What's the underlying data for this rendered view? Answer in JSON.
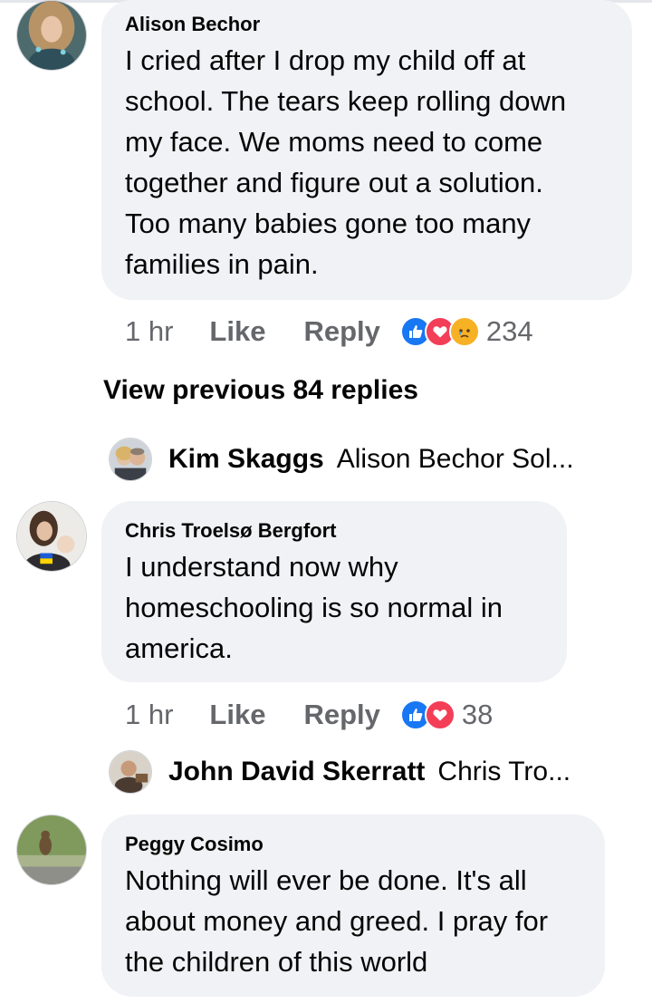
{
  "comments": [
    {
      "author": "Alison Bechor",
      "lines": [
        "I cried after I drop my child off at",
        "school. The tears keep rolling down",
        "my face. We moms need to come",
        "together and figure out a solution.",
        "Too many babies gone too many",
        "families in pain."
      ],
      "time": "1 hr",
      "like": "Like",
      "reply": "Reply",
      "reaction_count": "234",
      "reactions": [
        "like-icon",
        "love-icon",
        "sad-icon"
      ]
    },
    {
      "author": "Chris Troelsø Bergfort",
      "lines": [
        "I understand now why",
        "homeschooling is so normal in",
        "america."
      ],
      "time": "1 hr",
      "like": "Like",
      "reply": "Reply",
      "reaction_count": "38",
      "reactions": [
        "like-icon",
        "love-icon"
      ]
    },
    {
      "author": "Peggy Cosimo",
      "lines": [
        "Nothing will ever be done. It's all",
        "about money and greed. I pray for",
        "the children of this world"
      ]
    }
  ],
  "view_previous": "View previous 84 replies",
  "replies": [
    {
      "author": "Kim Skaggs",
      "preview": "Alison Bechor Sol..."
    },
    {
      "author": "John David Skerratt",
      "preview": "Chris Tro..."
    }
  ],
  "colors": {
    "bubble": "#f0f2f5",
    "meta_text": "#65676b",
    "like_blue": "#1877f2",
    "love_red": "#f33e58",
    "sad_yellow": "#f7b125"
  }
}
